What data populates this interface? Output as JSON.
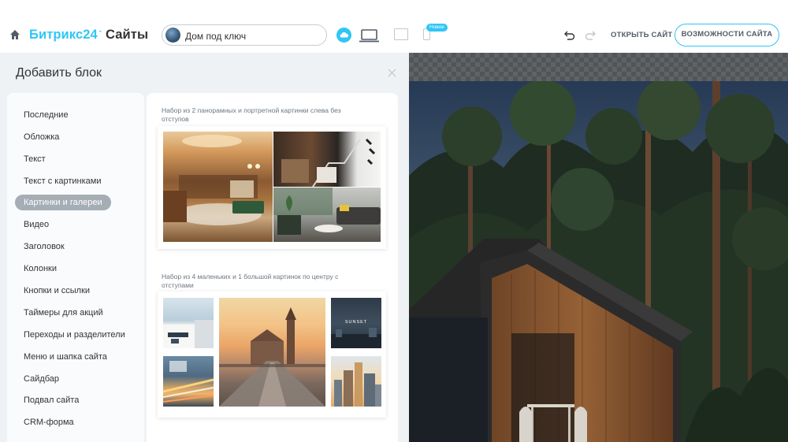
{
  "header": {
    "brand_part1": "Битрикс",
    "brand_part2": "24",
    "brand_part3": "Сайты",
    "site_name": "Дом под ключ",
    "new_badge": "Новое",
    "open_site_label": "ОТКРЫТЬ САЙТ",
    "features_label": "ВОЗМОЖНОСТИ САЙТА",
    "icons": [
      "home-icon",
      "cloud-icon",
      "laptop-icon",
      "tablet-icon",
      "phone-icon",
      "undo-icon",
      "redo-icon"
    ]
  },
  "panel": {
    "title": "Добавить блок",
    "categories": [
      "Последние",
      "Обложка",
      "Текст",
      "Текст с картинками",
      "Картинки и галереи",
      "Видео",
      "Заголовок",
      "Колонки",
      "Кнопки и ссылки",
      "Таймеры для акций",
      "Переходы и разделители",
      "Меню и шапка сайта",
      "Сайдбар",
      "Подвал сайта",
      "CRM-форма"
    ],
    "active_category": "Картинки и галереи",
    "blocks": [
      {
        "caption": "Набор из 2 панорамных и портретной картинки слева без отступов"
      },
      {
        "caption": "Набор из 4 маленьких и 1 большой картинок по центру с отступами",
        "sunset_text": "SUNSET"
      }
    ]
  },
  "colors": {
    "accent": "#2fc6f6",
    "panel_bg": "#eef2f4",
    "active_pill": "#a5adb5"
  }
}
